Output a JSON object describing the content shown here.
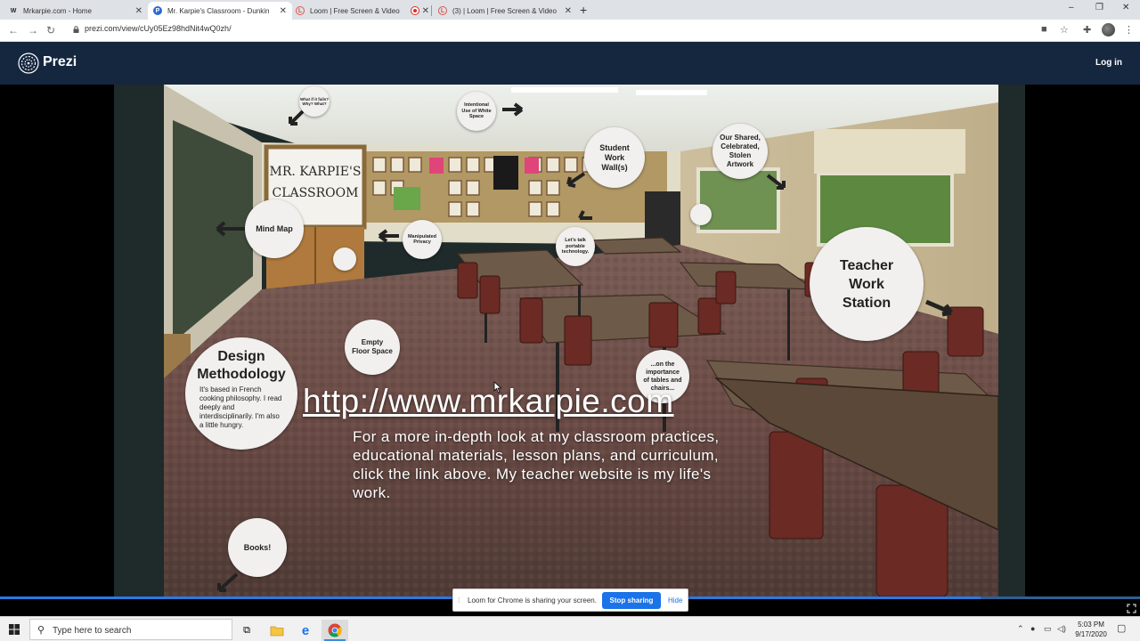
{
  "browser": {
    "tabs": [
      {
        "title": "Mrkarpie.com - Home",
        "favicon": "W",
        "active": false,
        "recording": false
      },
      {
        "title": "Mr. Karpie's Classroom - Dunkin",
        "favicon": "P",
        "active": true,
        "recording": false
      },
      {
        "title": "Loom | Free Screen & Video",
        "favicon": "L",
        "active": false,
        "recording": true
      },
      {
        "title": "(3) | Loom | Free Screen & Video",
        "favicon": "L",
        "active": false,
        "recording": false
      }
    ],
    "new_tab_glyph": "+",
    "url": "prezi.com/view/cUy05Ez98hdNit4wQ0zh/",
    "window_controls": {
      "minimize": "–",
      "restore": "❐",
      "close": "✕"
    }
  },
  "prezi": {
    "brand": "Prezi",
    "login_label": "Log in",
    "whiteboard_text": "Mr. Karpie's Classroom",
    "bubbles": {
      "what_fail": "What if it fails? Why? What?",
      "white_space": "Intentional Use of White Space",
      "student_work": "Student Work Wall(s)",
      "shared_artwork": "Our Shared, Celebrated, Stolen Artwork",
      "mind_map": "Mind Map",
      "manipulated_privacy": "Manipulated Privacy",
      "portable_tech": "Let's talk portable technology.",
      "teacher_station": "Teacher Work Station",
      "design_title": "Design Methodology",
      "design_body": "It's based in French cooking philosophy. I read deeply and interdisciplinarily. I'm also a little hungry.",
      "empty_floor": "Empty Floor Space",
      "tables_chairs": "...on the importance of tables and chairs...",
      "books": "Books!"
    },
    "site_link": "http://www.mrkarpie.com",
    "site_description": "For a more in-depth look at my classroom practices, educational materials, lesson plans, and curriculum, click the link above. My teacher website is my life's work.",
    "progress_fraction": 0.86
  },
  "loom": {
    "message": "Loom for Chrome is sharing your screen.",
    "stop_label": "Stop sharing",
    "hide_label": "Hide"
  },
  "taskbar": {
    "search_placeholder": "Type here to search",
    "time": "5:03 PM",
    "date": "9/17/2020"
  },
  "colors": {
    "prezi_header": "#15263f",
    "loom_blue": "#1a73e8",
    "recording_red": "#d93025"
  }
}
